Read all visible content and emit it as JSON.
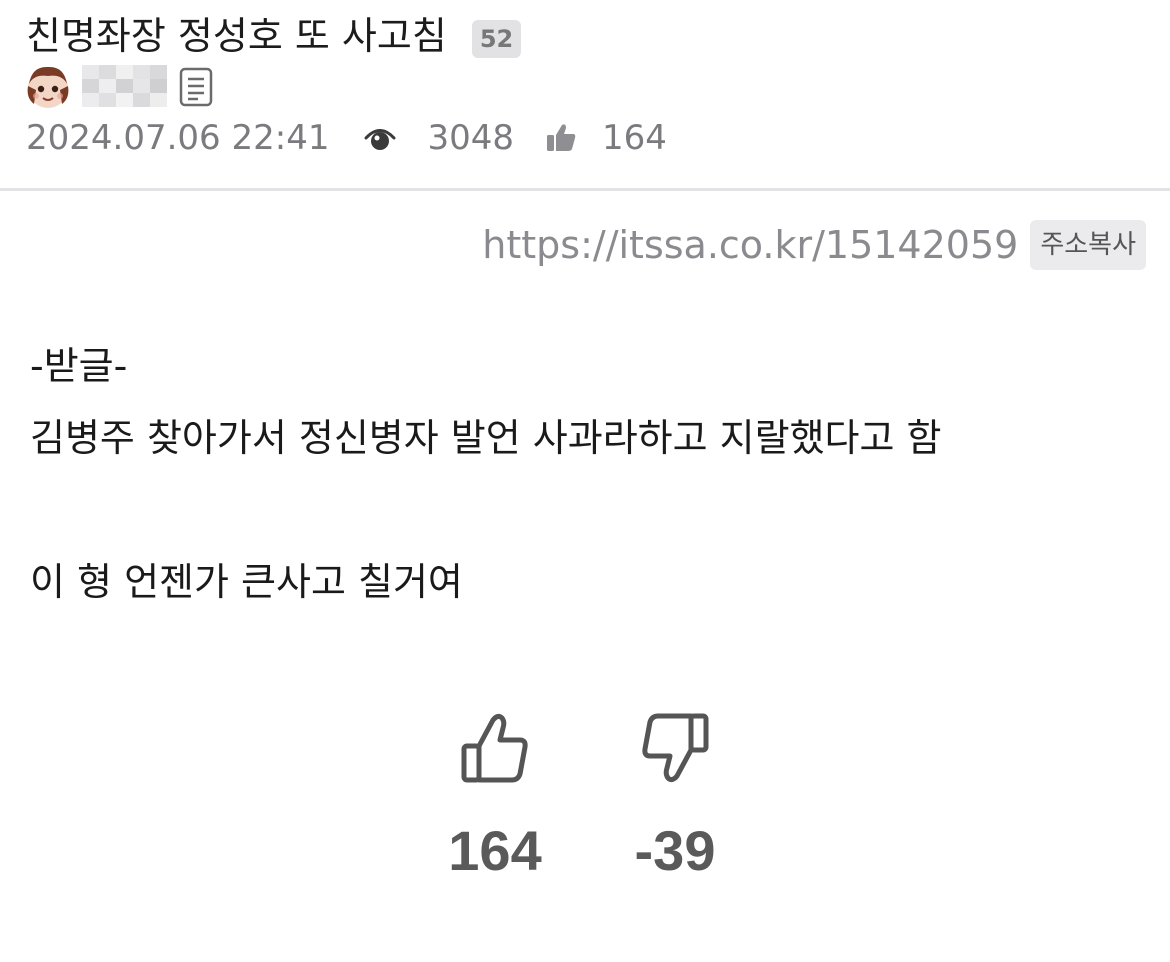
{
  "post": {
    "title": "친명좌장 정성호 또 사고침",
    "comment_count": "52",
    "author": "",
    "date": "2024.07.06 22:41",
    "views": "3048",
    "likes": "164"
  },
  "link": {
    "url": "https://itssa.co.kr/15142059",
    "copy_label": "주소복사"
  },
  "body": {
    "lines": [
      "-받글-",
      "김병주 찾아가서 정신병자 발언 사과라하고 지랄했다고 함",
      "",
      "이 형 언젠가 큰사고 칠거여"
    ]
  },
  "votes": {
    "up": "164",
    "down": "-39"
  },
  "icons": {
    "views": "eye-icon",
    "likes": "thumbs-up-icon",
    "author_posts": "document-icon",
    "upvote": "thumbs-up-outline-icon",
    "downvote": "thumbs-down-outline-icon"
  },
  "colors": {
    "meta_text": "#7a7a7f",
    "badge_bg": "#e2e2e5",
    "vote_count": "#5a5a5a"
  }
}
